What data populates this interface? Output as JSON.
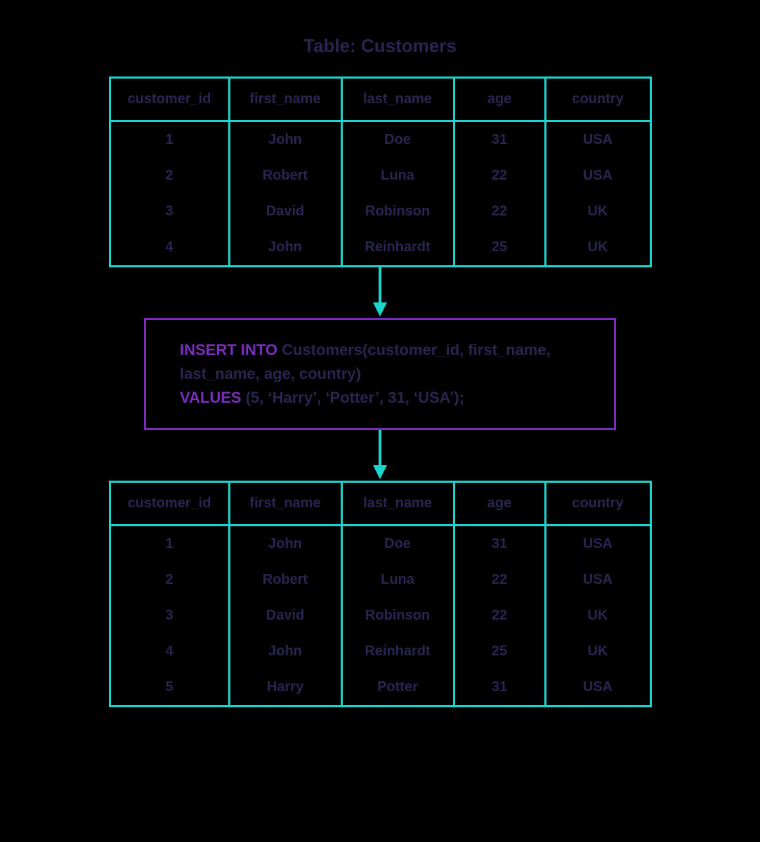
{
  "title": "Table: Customers",
  "columns": [
    "customer_id",
    "first_name",
    "last_name",
    "age",
    "country"
  ],
  "table_before": {
    "rows": [
      {
        "customer_id": "1",
        "first_name": "John",
        "last_name": "Doe",
        "age": "31",
        "country": "USA"
      },
      {
        "customer_id": "2",
        "first_name": "Robert",
        "last_name": "Luna",
        "age": "22",
        "country": "USA"
      },
      {
        "customer_id": "3",
        "first_name": "David",
        "last_name": "Robinson",
        "age": "22",
        "country": "UK"
      },
      {
        "customer_id": "4",
        "first_name": "John",
        "last_name": "Reinhardt",
        "age": "25",
        "country": "UK"
      }
    ]
  },
  "sql": {
    "kw1": "INSERT INTO",
    "line1_rest": " Customers(customer_id, first_name, last_name, age, country)",
    "kw2": "VALUES",
    "line2_rest": " (5, ‘Harry’, ‘Potter’, 31, ‘USA’);"
  },
  "table_after": {
    "rows": [
      {
        "customer_id": "1",
        "first_name": "John",
        "last_name": "Doe",
        "age": "31",
        "country": "USA"
      },
      {
        "customer_id": "2",
        "first_name": "Robert",
        "last_name": "Luna",
        "age": "22",
        "country": "USA"
      },
      {
        "customer_id": "3",
        "first_name": "David",
        "last_name": "Robinson",
        "age": "22",
        "country": "UK"
      },
      {
        "customer_id": "4",
        "first_name": "John",
        "last_name": "Reinhardt",
        "age": "25",
        "country": "UK"
      },
      {
        "customer_id": "5",
        "first_name": "Harry",
        "last_name": "Potter",
        "age": "31",
        "country": "USA"
      }
    ]
  }
}
